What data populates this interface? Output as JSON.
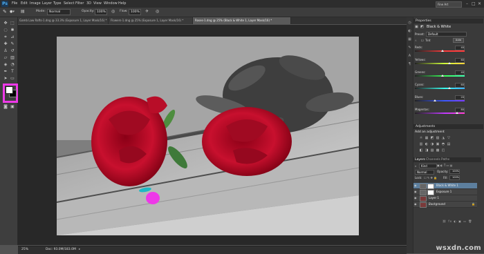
{
  "menubar": {
    "logo": "Ps",
    "items": [
      "File",
      "Edit",
      "Image",
      "Layer",
      "Type",
      "Select",
      "Filter",
      "3D",
      "View",
      "Window",
      "Help"
    ],
    "workspace": "Fine Art",
    "minimize": "–",
    "maximize": "□",
    "close": "✕"
  },
  "options": {
    "mode_label": "Mode:",
    "mode_value": "Normal",
    "opacity_label": "Opacity:",
    "opacity_value": "100%",
    "flow_label": "Flow:",
    "flow_value": "100%"
  },
  "tabs": [
    "Gamb Law Rafts-1.dng @ 33.3% (Exposure 1, Layer Mask/16) *",
    "Flowers-1.dng @ 25% (Exposure 1, Layer Mask/16) *",
    "Roses-1.dng @ 25% (Black & White 1, Layer Mask/16) *"
  ],
  "status": {
    "zoom": "25%",
    "doc": "Doc: 93.0M/183.0M"
  },
  "properties": {
    "tab": "Properties",
    "title": "Black & White",
    "preset_label": "Preset:",
    "preset_value": "Default",
    "tint_label": "Tint",
    "auto_label": "Auto",
    "sliders": [
      {
        "label": "Reds:",
        "value": "40",
        "pct": 0.55,
        "from": "#ff3b3b",
        "to": "#ff3b3b"
      },
      {
        "label": "Yellows:",
        "value": "60",
        "pct": 0.7,
        "from": "#d0ff3b",
        "to": "#ffd23b"
      },
      {
        "label": "Greens:",
        "value": "40",
        "pct": 0.55,
        "from": "#3bff5a",
        "to": "#3bffb0"
      },
      {
        "label": "Cyans:",
        "value": "60",
        "pct": 0.7,
        "from": "#3bfff0",
        "to": "#3bb0ff"
      },
      {
        "label": "Blues:",
        "value": "20",
        "pct": 0.4,
        "from": "#3b5aff",
        "to": "#7a3bff"
      },
      {
        "label": "Magentas:",
        "value": "80",
        "pct": 0.85,
        "from": "#c03bff",
        "to": "#ff3bd0"
      }
    ]
  },
  "adjustments": {
    "tab": "Adjustments",
    "subtitle": "Add an adjustment",
    "row1": [
      "☼",
      "▦",
      "◩",
      "▧",
      "◮",
      "▽"
    ],
    "row2": [
      "▥",
      "◐",
      "◑",
      "▣",
      "◓",
      "▤"
    ],
    "row3": [
      "◧",
      "◨",
      "▨",
      "▩",
      "◰"
    ]
  },
  "layers": {
    "tabs": [
      "Layers",
      "Channels",
      "Paths"
    ],
    "kind_label": "Kind",
    "blend_value": "Normal",
    "opacity_label": "Opacity:",
    "opacity_value": "100%",
    "lock_label": "Lock:",
    "fill_label": "Fill:",
    "fill_value": "100%",
    "items": [
      {
        "name": "Black & White 1",
        "selected": true
      },
      {
        "name": "Exposure 1",
        "selected": false
      },
      {
        "name": "Layer 1",
        "selected": false
      },
      {
        "name": "Background",
        "selected": false
      }
    ]
  },
  "watermark": "wsxdn.com",
  "colors": {
    "highlight": "#ee38e8",
    "rose": "#c8102e",
    "selected_layer": "#5d7f9e"
  }
}
